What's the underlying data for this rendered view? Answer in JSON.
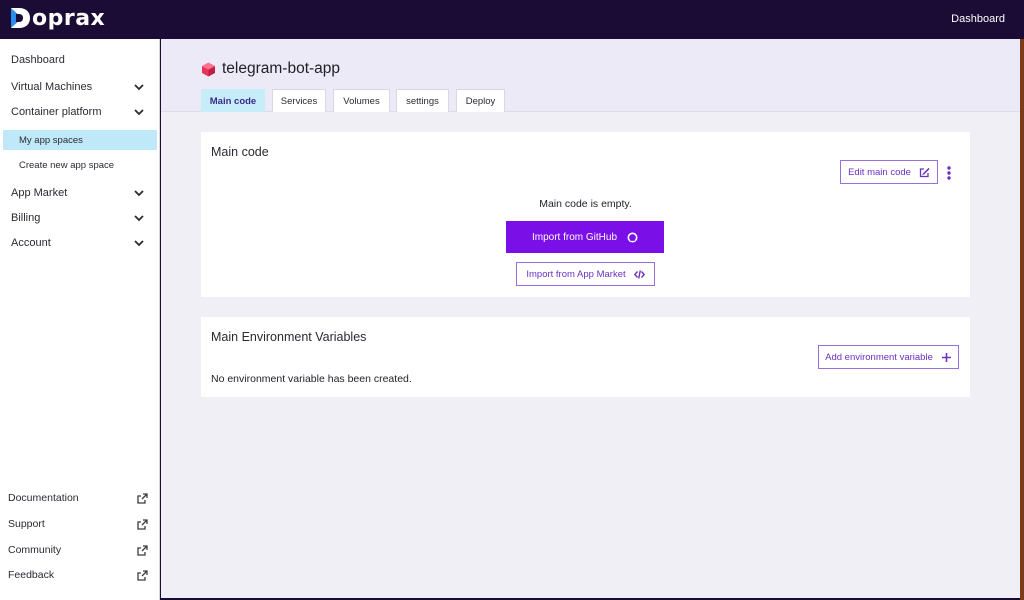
{
  "topbar": {
    "logo_text": "oprax",
    "dashboard_link": "Dashboard"
  },
  "sidebar": {
    "items": [
      {
        "label": "Dashboard",
        "has_chevron": false
      },
      {
        "label": "Virtual Machines",
        "has_chevron": true
      },
      {
        "label": "Container platform",
        "has_chevron": true
      },
      {
        "label": "App Market",
        "has_chevron": true
      },
      {
        "label": "Billing",
        "has_chevron": true
      },
      {
        "label": "Account",
        "has_chevron": true
      }
    ],
    "subitems": [
      {
        "label": "My app spaces",
        "active": true
      },
      {
        "label": "Create new app space",
        "active": false
      }
    ],
    "bottom": [
      {
        "label": "Documentation",
        "icon": "external-link-icon"
      },
      {
        "label": "Support",
        "icon": "external-link-icon"
      },
      {
        "label": "Community",
        "icon": "external-link-icon"
      },
      {
        "label": "Feedback",
        "icon": "external-link-icon"
      }
    ]
  },
  "app": {
    "title": "telegram-bot-app",
    "icon": "cube-icon",
    "tabs": [
      {
        "label": "Main code",
        "active": true
      },
      {
        "label": "Services",
        "active": false
      },
      {
        "label": "Volumes",
        "active": false
      },
      {
        "label": "settings",
        "active": false
      },
      {
        "label": "Deploy",
        "active": false
      }
    ]
  },
  "main_code": {
    "title": "Main code",
    "edit_button": "Edit main code",
    "empty_message": "Main code is empty.",
    "import_github_button": "Import from GitHub",
    "import_market_button": "Import from App Market"
  },
  "env": {
    "title": "Main Environment Variables",
    "add_button": "Add environment variable",
    "empty_message": "No environment variable has been created."
  },
  "colors": {
    "topbar": "#1b0c35",
    "accent": "#7b0fe8",
    "active_tab": "#c7ecfa",
    "active_sidebar": "#bfe9f8",
    "logo_blue": "#2b8cf0",
    "cube": "#e8335a"
  }
}
